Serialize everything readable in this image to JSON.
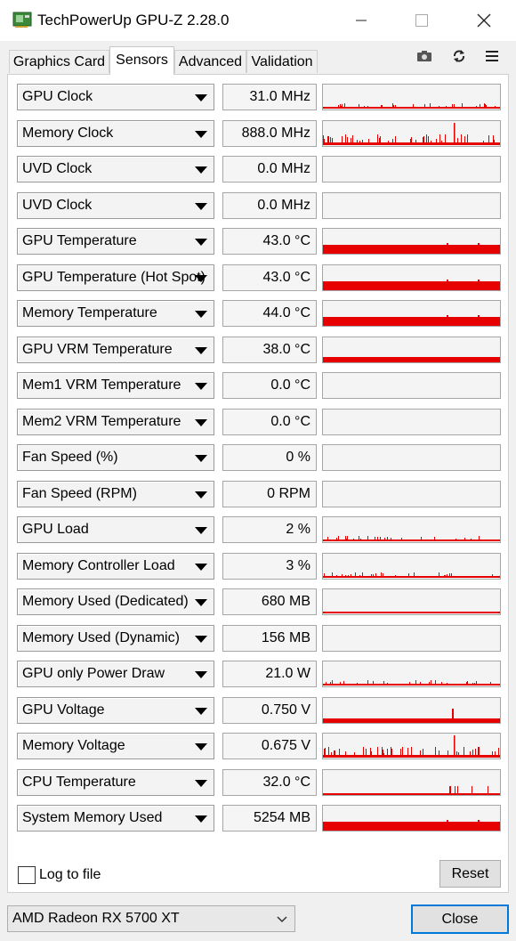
{
  "window": {
    "title": "TechPowerUp GPU-Z 2.28.0"
  },
  "tabs": [
    {
      "label": "Graphics Card",
      "active": false
    },
    {
      "label": "Sensors",
      "active": true
    },
    {
      "label": "Advanced",
      "active": false
    },
    {
      "label": "Validation",
      "active": false
    }
  ],
  "toolbar_icons": [
    "camera-icon",
    "refresh-icon",
    "menu-icon"
  ],
  "accent_graph_color": "#e60000",
  "sensors": [
    {
      "name": "GPU Clock",
      "value": "31.0 MHz",
      "graph": "spikes-low"
    },
    {
      "name": "Memory Clock",
      "value": "888.0 MHz",
      "graph": "spikes-mid"
    },
    {
      "name": "UVD Clock",
      "value": "0.0 MHz",
      "graph": "none"
    },
    {
      "name": "UVD Clock",
      "value": "0.0 MHz",
      "graph": "none"
    },
    {
      "name": "GPU Temperature",
      "value": "43.0 °C",
      "graph": "bar-thick"
    },
    {
      "name": "GPU Temperature (Hot Spot)",
      "value": "43.0 °C",
      "graph": "bar-thick"
    },
    {
      "name": "Memory Temperature",
      "value": "44.0 °C",
      "graph": "bar-thick"
    },
    {
      "name": "GPU VRM Temperature",
      "value": "38.0 °C",
      "graph": "bar-thin"
    },
    {
      "name": "Mem1 VRM Temperature",
      "value": "0.0 °C",
      "graph": "none"
    },
    {
      "name": "Mem2 VRM Temperature",
      "value": "0.0 °C",
      "graph": "none"
    },
    {
      "name": "Fan Speed (%)",
      "value": "0 %",
      "graph": "none"
    },
    {
      "name": "Fan Speed (RPM)",
      "value": "0 RPM",
      "graph": "none"
    },
    {
      "name": "GPU Load",
      "value": "2 %",
      "graph": "spikes-low"
    },
    {
      "name": "Memory Controller Load",
      "value": "3 %",
      "graph": "spikes-low"
    },
    {
      "name": "Memory Used (Dedicated)",
      "value": "680 MB",
      "graph": "line-mid"
    },
    {
      "name": "Memory Used (Dynamic)",
      "value": "156 MB",
      "graph": "none"
    },
    {
      "name": "GPU only Power Draw",
      "value": "21.0 W",
      "graph": "spikes-low"
    },
    {
      "name": "GPU Voltage",
      "value": "0.750 V",
      "graph": "bar-spike"
    },
    {
      "name": "Memory Voltage",
      "value": "0.675 V",
      "graph": "spikes-mid"
    },
    {
      "name": "CPU Temperature",
      "value": "32.0 °C",
      "graph": "line-low"
    },
    {
      "name": "System Memory Used",
      "value": "5254 MB",
      "graph": "bar-thick"
    }
  ],
  "log_to_file": {
    "label": "Log to file",
    "checked": false
  },
  "reset_label": "Reset",
  "gpu_select": {
    "value": "AMD Radeon RX 5700 XT"
  },
  "close_label": "Close"
}
